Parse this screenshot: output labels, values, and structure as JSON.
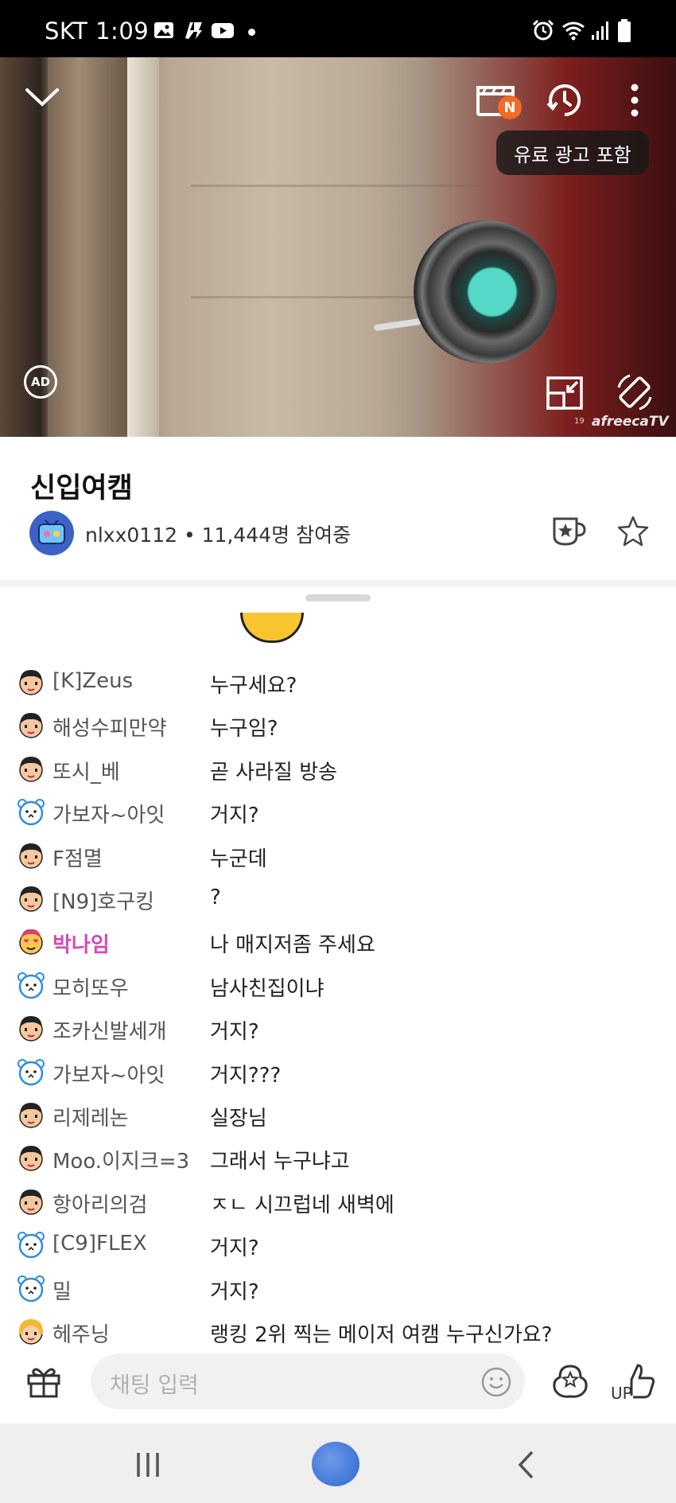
{
  "status_bar": {
    "carrier_time": "SKT 1:09"
  },
  "video": {
    "paid_ad_notice": "유료 광고 포함",
    "ad_badge": "AD",
    "new_badge": "N",
    "watermark": "afreecaTV",
    "age_mark": "19"
  },
  "broadcast": {
    "title": "신입여캠",
    "streamer_meta": "nlxx0112 • 11,444명 참여중"
  },
  "chat": {
    "messages": [
      {
        "nick": "[K]Zeus",
        "text": "누구세요?",
        "icon": "boy-face-icon"
      },
      {
        "nick": "해성수피만약",
        "text": "누구임?",
        "icon": "boy-face-icon"
      },
      {
        "nick": "또시_베",
        "text": "곧 사라질 방송",
        "icon": "boy-face-icon"
      },
      {
        "nick": "가보자~아잇",
        "text": "거지?",
        "icon": "bear-face-icon"
      },
      {
        "nick": "F점멸",
        "text": "누군데",
        "icon": "boy-face-icon"
      },
      {
        "nick": "[N9]호구킹",
        "text": "?",
        "icon": "boy-face-icon"
      },
      {
        "nick": "박나임",
        "text": "나 매지저좀 주세요",
        "icon": "heart-eyes-icon",
        "vip": true
      },
      {
        "nick": "모히또우",
        "text": "남사친집이냐",
        "icon": "bear-face-icon"
      },
      {
        "nick": "조카신발세개",
        "text": "거지?",
        "icon": "boy-face-icon"
      },
      {
        "nick": "가보자~아잇",
        "text": "거지???",
        "icon": "bear-face-icon"
      },
      {
        "nick": "리제레논",
        "text": "실장님",
        "icon": "boy-face-icon"
      },
      {
        "nick": "Moo.이지크=3",
        "text": "그래서 누구냐고",
        "icon": "boy-face-icon"
      },
      {
        "nick": "항아리의검",
        "text": "ㅈㄴ 시끄럽네 새벽에",
        "icon": "boy-face-icon"
      },
      {
        "nick": "[C9]FLEX",
        "text": "거지?",
        "icon": "bear-face-icon"
      },
      {
        "nick": "밀",
        "text": "거지?",
        "icon": "bear-face-icon"
      },
      {
        "nick": "헤주닝",
        "text": "랭킹 2위 찍는 메이저 여캠 누구신가요?",
        "icon": "girl-face-icon"
      }
    ]
  },
  "input": {
    "placeholder": "채팅 입력",
    "up_label": "UP"
  },
  "colors": {
    "accent_orange": "#f06b26",
    "vip_nick": "#d24bb6",
    "home_button": "#2f67d2"
  }
}
